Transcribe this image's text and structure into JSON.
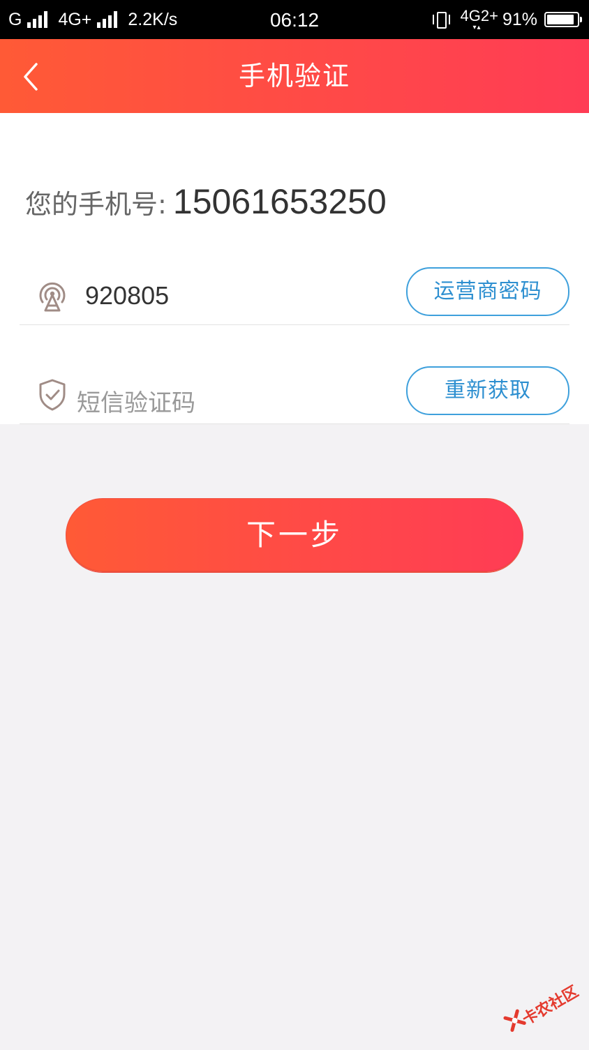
{
  "status_bar": {
    "carrier1": "G",
    "carrier2": "4G+",
    "speed": "2.2K/s",
    "time": "06:12",
    "network": "4G",
    "network_sub": "2+",
    "battery": "91%",
    "battery_level": 0.91
  },
  "header": {
    "title": "手机验证",
    "back_icon": "chevron-left-icon"
  },
  "form": {
    "phone_label": "您的手机号:",
    "phone_number": "15061653250",
    "carrier_password": {
      "icon": "broadcast-tower-icon",
      "value": "920805",
      "button_label": "运营商密码"
    },
    "sms_code": {
      "icon": "shield-check-icon",
      "placeholder": "短信验证码",
      "button_label": "重新获取"
    }
  },
  "next_button": {
    "label": "下一步"
  },
  "watermark": {
    "text": "卡农社区"
  },
  "colors": {
    "accent_start": "#ff5a36",
    "accent_end": "#ff3c55",
    "link_blue": "#2d8fd0",
    "background": "#f3f2f4"
  }
}
